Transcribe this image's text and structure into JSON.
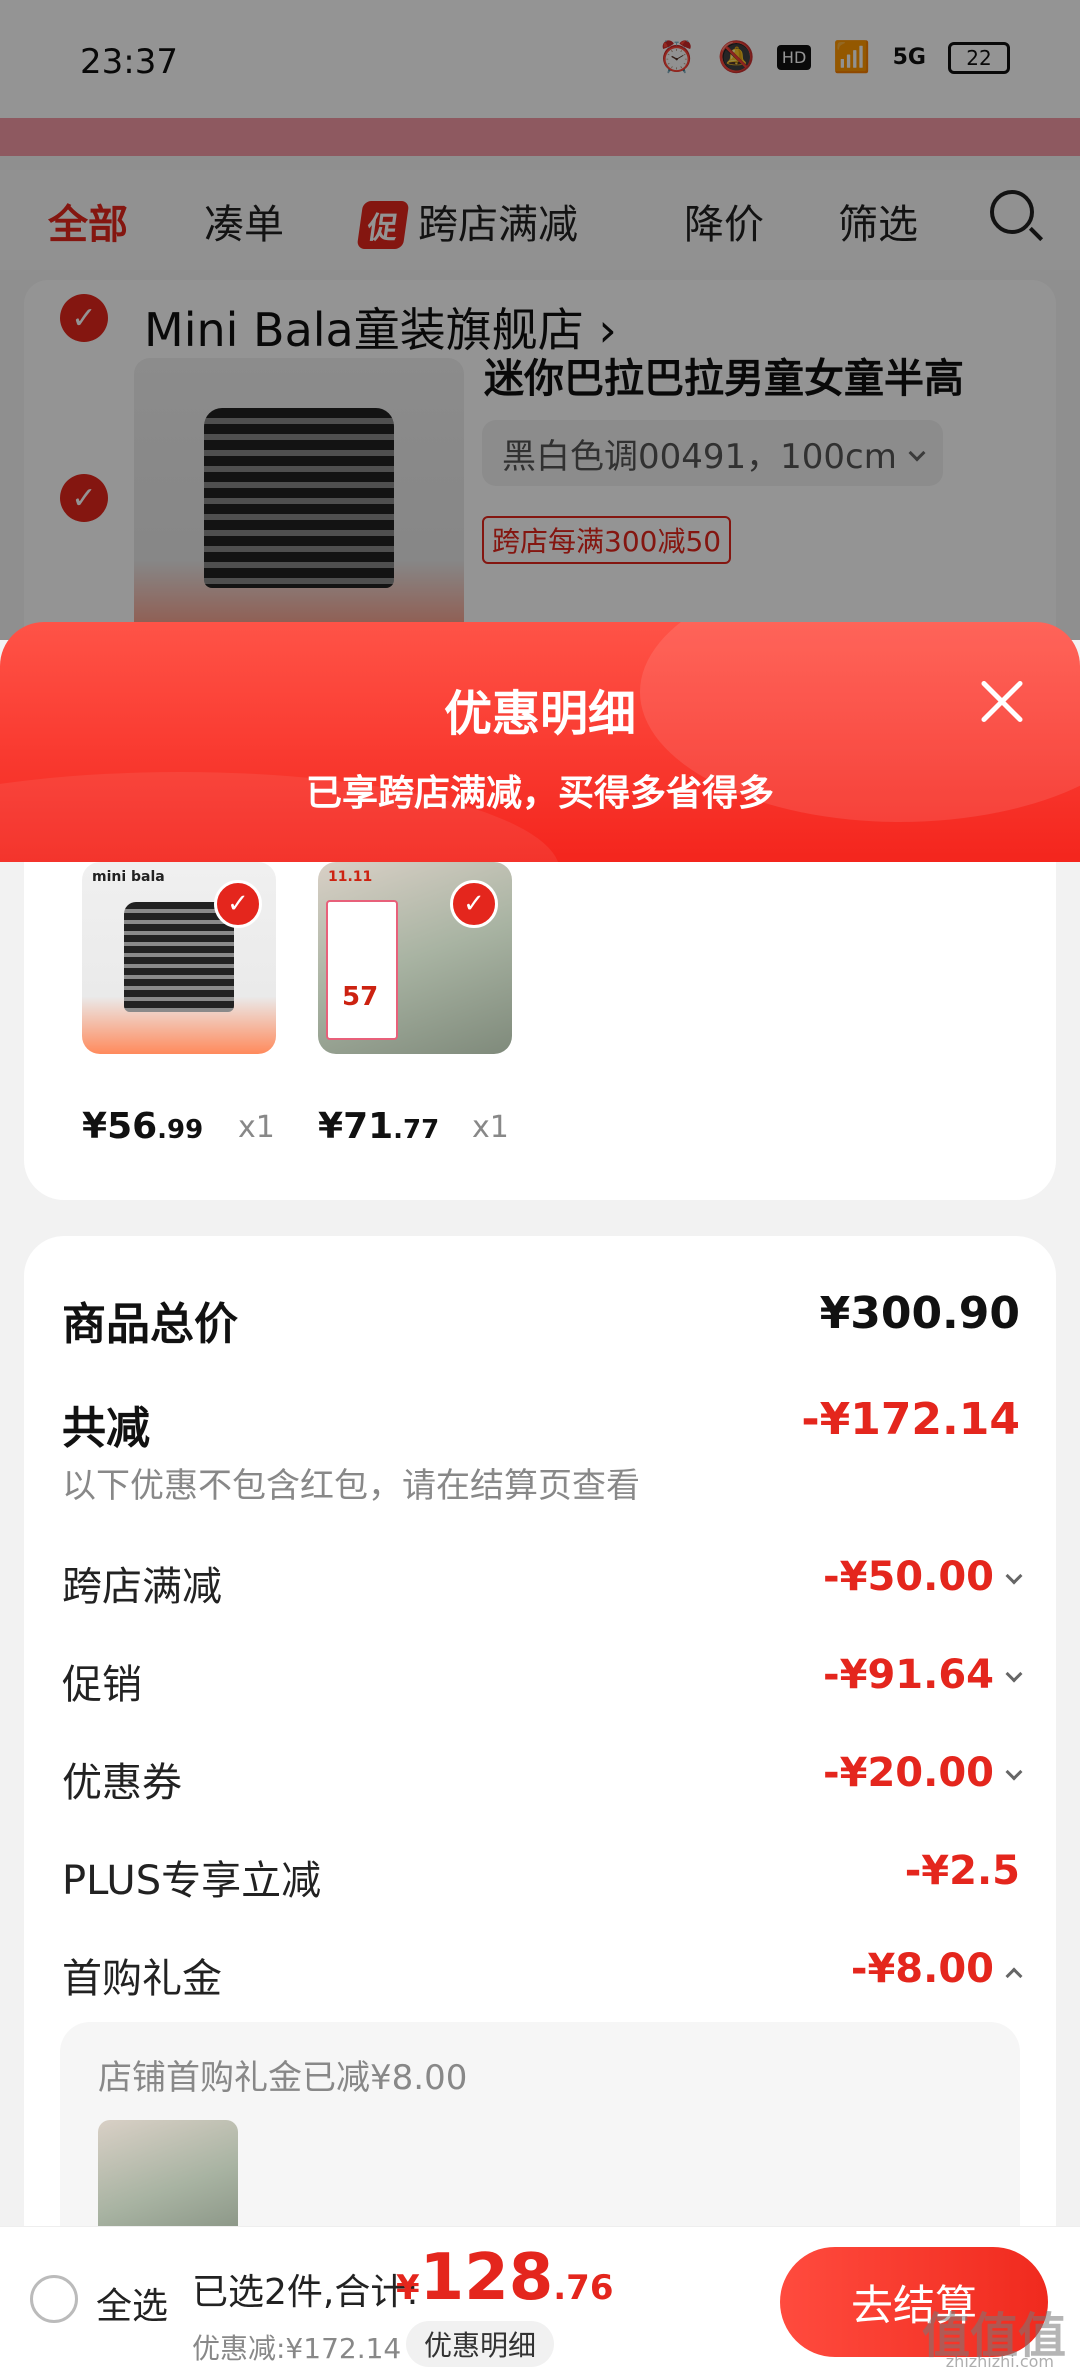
{
  "status_bar": {
    "time": "23:37",
    "network": "5G",
    "hd": "HD",
    "battery": "22"
  },
  "filter_tabs": {
    "all": "全部",
    "combine": "凑单",
    "promo_badge": "促",
    "cross_store": "跨店满减",
    "price_drop": "降价",
    "filter": "筛选"
  },
  "shop": {
    "name": "Mini Bala童装旗舰店",
    "product_title": "迷你巴拉巴拉男童女童半高",
    "sku": "黑白色调00491，100cm",
    "promo_tag": "跨店每满300减50"
  },
  "sheet": {
    "title": "优惠明细",
    "subtitle": "已享跨店满减，买得多省得多"
  },
  "items": [
    {
      "logo": "mini bala",
      "price_symbol": "¥",
      "price_int": "56",
      "price_dec": ".99",
      "qty": "x1"
    },
    {
      "logo": "11.11",
      "badge_num": "57",
      "price_symbol": "¥",
      "price_int": "71",
      "price_dec": ".77",
      "qty": "x1"
    }
  ],
  "summary": {
    "total_label": "商品总价",
    "total_value": "¥300.90",
    "reduce_label": "共减",
    "reduce_value": "-¥172.14",
    "hint": "以下优惠不包含红包，请在结算页查看",
    "rows": [
      {
        "label": "跨店满减",
        "value": "-¥50.00"
      },
      {
        "label": "促销",
        "value": "-¥91.64"
      },
      {
        "label": "优惠券",
        "value": "-¥20.00"
      },
      {
        "label": "PLUS专享立减",
        "value": "-¥2.5"
      },
      {
        "label": "首购礼金",
        "value": "-¥8.00"
      }
    ],
    "gift_text": "店铺首购礼金已减¥8.00"
  },
  "bottom_bar": {
    "select_all": "全选",
    "selected_prefix": "已选2件,合计:",
    "total_symbol": "¥",
    "total_int": "128",
    "total_dec": ".76",
    "discount": "优惠减:¥172.14",
    "detail_button": "优惠明细",
    "checkout_button": "去结算"
  },
  "watermark": {
    "text": "值值值",
    "sub": "zhizhizhi.com"
  },
  "colors": {
    "accent": "#e4261d",
    "sheet_header": "#f4251d",
    "background": "#f2f2f2"
  }
}
